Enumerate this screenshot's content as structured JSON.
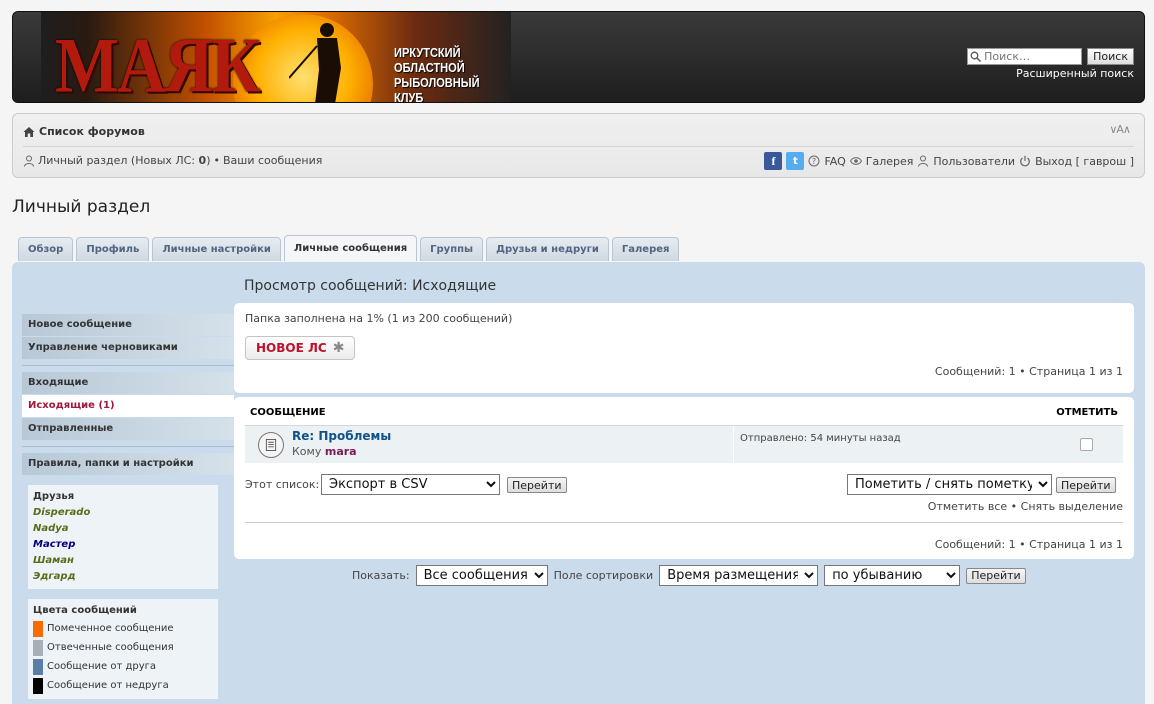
{
  "header": {
    "logo": "МАЯК",
    "club_name_line1": "ИРКУТСКИЙ ОБЛАСТНОЙ",
    "club_name_line2": "РЫБОЛОВНЫЙ КЛУБ",
    "search_placeholder": "Поиск…",
    "search_button": "Поиск",
    "advanced_search": "Расширенный поиск"
  },
  "navbar": {
    "forum_list": "Список форумов",
    "font_resize": "∨A∧",
    "personal_section": "Личный раздел (Новых ЛС: ",
    "new_pm_count": "0",
    "personal_close": ")",
    "bullet": "•",
    "your_posts": "Ваши сообщения",
    "facebook": "f",
    "twitter": "t",
    "faq": "FAQ",
    "gallery": "Галерея",
    "users": "Пользователи",
    "logout": "Выход [ гаврош ]"
  },
  "page_title": "Личный раздел",
  "tabs": [
    "Обзор",
    "Профиль",
    "Личные настройки",
    "Личные сообщения",
    "Группы",
    "Друзья и недруги",
    "Галерея"
  ],
  "sidebar": {
    "new_message": "Новое сообщение",
    "drafts": "Управление черновиками",
    "inbox": "Входящие",
    "outbox": "Исходящие (1)",
    "sent": "Отправленные",
    "rules": "Правила, папки и настройки",
    "friends_title": "Друзья",
    "friends": [
      {
        "name": "Disperado",
        "color": "#5a6b1a"
      },
      {
        "name": "Nadya",
        "color": "#5a6b1a"
      },
      {
        "name": "Мастер",
        "color": "#00007a"
      },
      {
        "name": "Шаман",
        "color": "#5a6b1a"
      },
      {
        "name": "Эдгард",
        "color": "#5a6b1a"
      }
    ],
    "colors_title": "Цвета сообщений",
    "colors": [
      {
        "label": "Помеченное сообщение",
        "color": "#f76b00"
      },
      {
        "label": "Отвеченные сообщения",
        "color": "#a8b0b6"
      },
      {
        "label": "Сообщение от друга",
        "color": "#5a7fa6"
      },
      {
        "label": "Сообщение от недруга",
        "color": "#000000"
      }
    ]
  },
  "content": {
    "title": "Просмотр сообщений: Исходящие",
    "folder_status": "Папка заполнена на 1% (1 из 200 сообщений)",
    "new_pm_button": "НОВОЕ ЛС",
    "pagination": "Сообщений: 1 • Страница 1 из 1",
    "col_message": "СООБЩЕНИЕ",
    "col_mark": "ОТМЕТИТЬ",
    "message": {
      "subject": "Re: Проблемы",
      "to_label": "Кому ",
      "to_user": "mara",
      "sent": "Отправлено: 54 минуты назад"
    },
    "this_list_label": "Этот список:",
    "export_option": "Экспорт в CSV",
    "go_button": "Перейти",
    "mark_option": "Пометить / снять пометку",
    "mark_all": "Отметить все",
    "unmark": "Снять выделение"
  },
  "display": {
    "show_label": "Показать:",
    "show_option": "Все сообщения",
    "sort_label": "Поле сортировки",
    "sort_option": "Время размещения",
    "order_option": "по убыванию",
    "go_button": "Перейти"
  }
}
